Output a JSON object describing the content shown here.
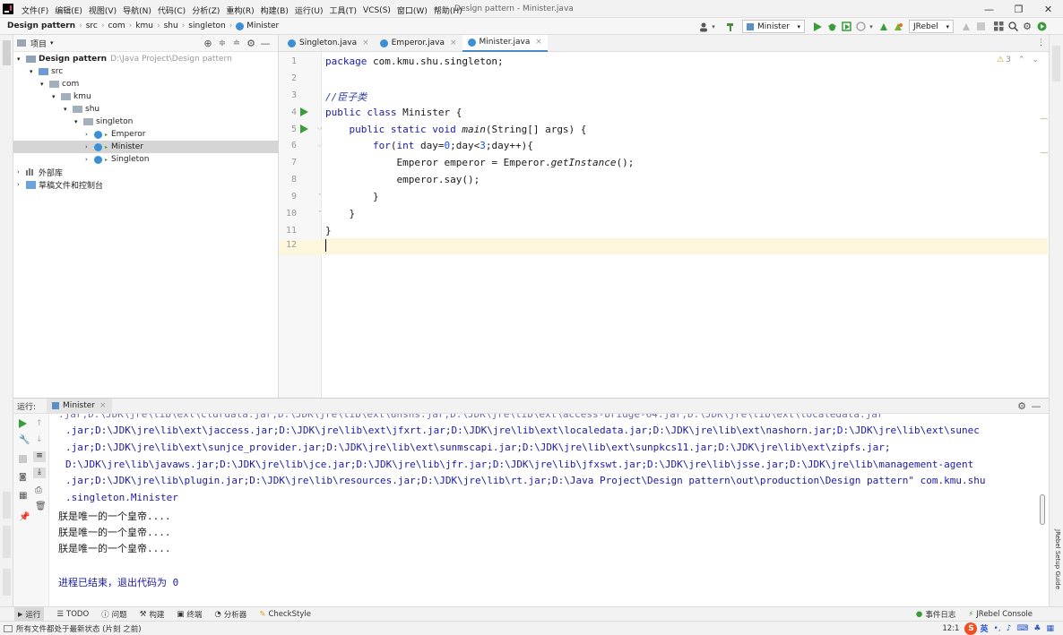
{
  "titlebar": {
    "menu": [
      "文件(F)",
      "编辑(E)",
      "视图(V)",
      "导航(N)",
      "代码(C)",
      "分析(Z)",
      "重构(R)",
      "构建(B)",
      "运行(U)",
      "工具(T)",
      "VCS(S)",
      "窗口(W)",
      "帮助(H)"
    ],
    "title": "Design pattern - Minister.java"
  },
  "navbar": {
    "breadcrumbs": [
      "Design pattern",
      "src",
      "com",
      "kmu",
      "shu",
      "singleton",
      "Minister"
    ],
    "run_config": "Minister",
    "jrebel": "JRebel"
  },
  "project": {
    "title": "项目",
    "tree": [
      {
        "label": "Design pattern",
        "hint": "D:\\Java Project\\Design pattern",
        "indent": 0,
        "kind": "module"
      },
      {
        "label": "src",
        "indent": 1,
        "kind": "folder"
      },
      {
        "label": "com",
        "indent": 2,
        "kind": "folder"
      },
      {
        "label": "kmu",
        "indent": 3,
        "kind": "folder"
      },
      {
        "label": "shu",
        "indent": 4,
        "kind": "folder"
      },
      {
        "label": "singleton",
        "indent": 5,
        "kind": "folder"
      },
      {
        "label": "Emperor",
        "indent": 6,
        "kind": "class"
      },
      {
        "label": "Minister",
        "indent": 6,
        "kind": "class",
        "selected": true
      },
      {
        "label": "Singleton",
        "indent": 6,
        "kind": "class"
      },
      {
        "label": "外部库",
        "indent": 0,
        "kind": "lib"
      },
      {
        "label": "草稿文件和控制台",
        "indent": 0,
        "kind": "scratch"
      }
    ]
  },
  "editor": {
    "tabs": [
      {
        "label": "Singleton.java",
        "active": false
      },
      {
        "label": "Emperor.java",
        "active": false
      },
      {
        "label": "Minister.java",
        "active": true
      }
    ],
    "warnings": "3",
    "lines": [
      "package com.kmu.shu.singleton;",
      "",
      "//臣子类",
      "public class Minister {",
      "    public static void main(String[] args) {",
      "        for(int day=0;day<3;day++){",
      "            Emperor emperor = Emperor.getInstance();",
      "            emperor.say();",
      "        }",
      "    }",
      "}",
      ""
    ]
  },
  "run": {
    "label": "运行:",
    "tab": "Minister",
    "console": [
      ".jar;D:\\JDK\\jre\\lib\\ext\\jaccess.jar;D:\\JDK\\jre\\lib\\ext\\jfxrt.jar;D:\\JDK\\jre\\lib\\ext\\localedata.jar;D:\\JDK\\jre\\lib\\ext\\nashorn.jar;D:\\JDK\\jre\\lib\\ext\\sunec",
      ".jar;D:\\JDK\\jre\\lib\\ext\\sunjce_provider.jar;D:\\JDK\\jre\\lib\\ext\\sunmscapi.jar;D:\\JDK\\jre\\lib\\ext\\sunpkcs11.jar;D:\\JDK\\jre\\lib\\ext\\zipfs.jar;",
      "D:\\JDK\\jre\\lib\\javaws.jar;D:\\JDK\\jre\\lib\\jce.jar;D:\\JDK\\jre\\lib\\jfr.jar;D:\\JDK\\jre\\lib\\jfxswt.jar;D:\\JDK\\jre\\lib\\jsse.jar;D:\\JDK\\jre\\lib\\management-agent",
      ".jar;D:\\JDK\\jre\\lib\\plugin.jar;D:\\JDK\\jre\\lib\\resources.jar;D:\\JDK\\jre\\lib\\rt.jar;D:\\Java Project\\Design pattern\\out\\production\\Design pattern\" com.kmu.shu",
      ".singleton.Minister"
    ],
    "output": [
      "朕是唯一的一个皇帝....",
      "朕是唯一的一个皇帝....",
      "朕是唯一的一个皇帝...."
    ],
    "exit": "进程已结束，退出代码为 0"
  },
  "toolwindows": [
    "运行",
    "TODO",
    "问题",
    "构建",
    "终端",
    "分析器",
    "CheckStyle"
  ],
  "toolwindows_right": [
    "事件日志",
    "JRebel Console"
  ],
  "side_labels": {
    "right": "JRebel Setup Guide"
  },
  "statusbar": {
    "text": "所有文件都处于最新状态 (片刻 之前)",
    "pos": "12:1",
    "ime": "英"
  },
  "colors": {
    "accent": "#4a88c7",
    "keyword": "#1a1aa6",
    "run_green": "#3a9d3a",
    "ime_brand": "#f04e23"
  }
}
